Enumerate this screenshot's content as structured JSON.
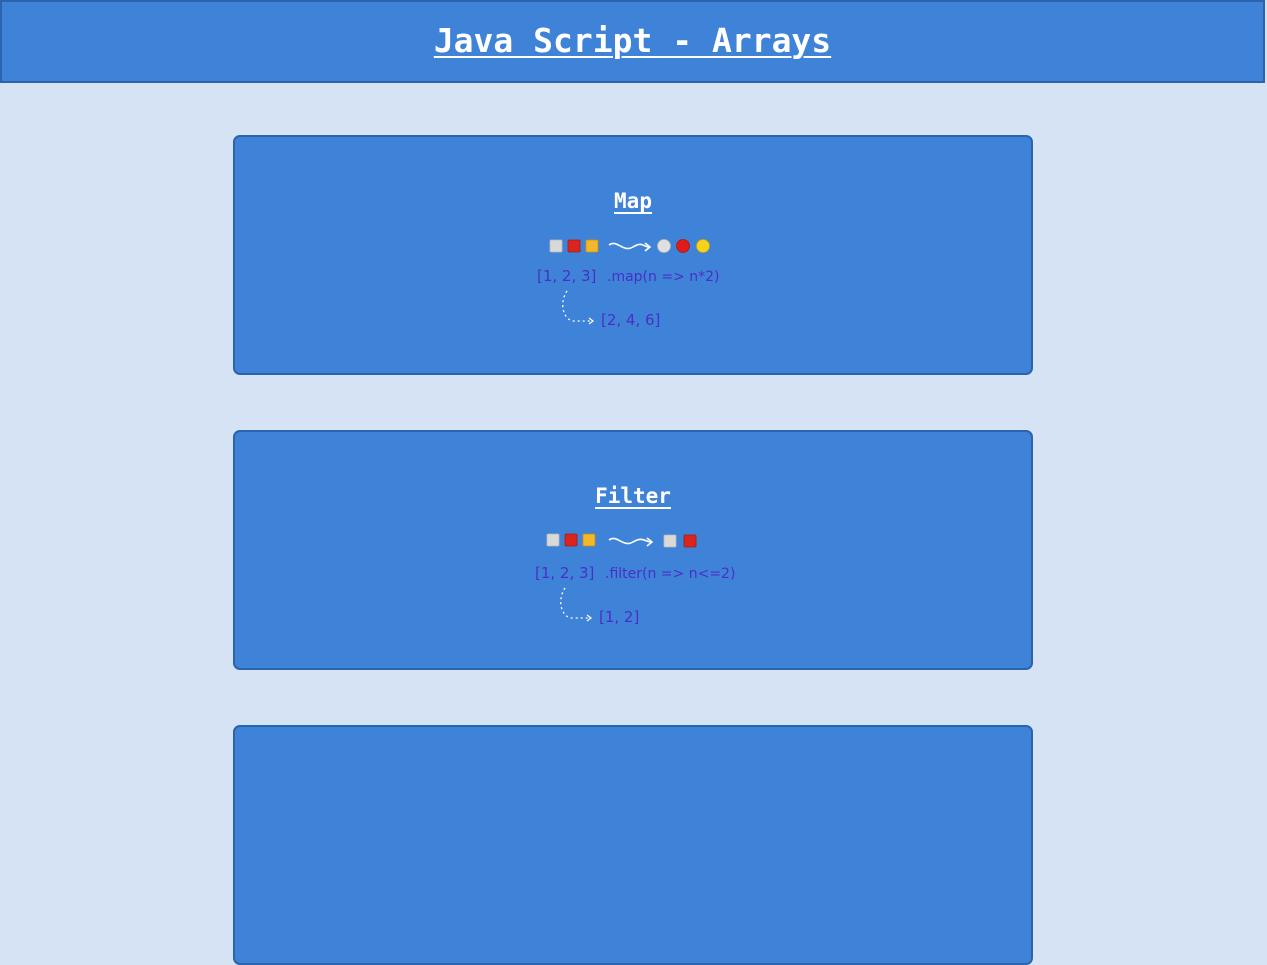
{
  "page": {
    "title": "Java Script - Arrays"
  },
  "cards": [
    {
      "title": "Map",
      "illustration": {
        "input_array": "[1, 2, 3]",
        "method": ".map(n => n*2)",
        "result": "[2, 4, 6]",
        "input_icons": [
          "white-square-icon",
          "red-square-icon",
          "yellow-square-icon"
        ],
        "output_icons": [
          "white-circle-icon",
          "red-circle-icon",
          "yellow-circle-icon"
        ]
      }
    },
    {
      "title": "Filter",
      "illustration": {
        "input_array": "[1, 2, 3]",
        "method": ".filter(n => n<=2)",
        "result": "[1, 2]",
        "input_icons": [
          "white-square-icon",
          "red-square-icon",
          "yellow-square-icon"
        ],
        "output_icons": [
          "white-square-icon",
          "red-square-icon"
        ]
      }
    },
    {
      "title": ""
    }
  ],
  "colors": {
    "background": "#d5e3f5",
    "card": "#3f83d9",
    "card_border": "#2b63ac",
    "handwriting": "#4a2fc4"
  }
}
